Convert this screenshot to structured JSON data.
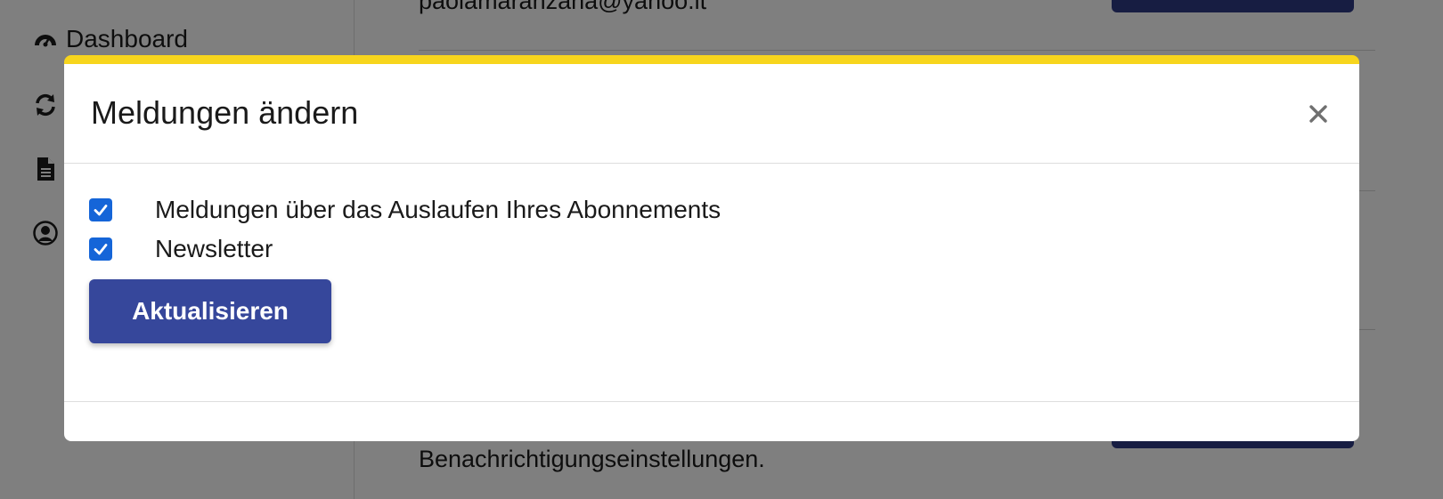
{
  "sidebar": {
    "items": [
      {
        "label": "Dashboard",
        "icon": "dashboard-icon"
      },
      {
        "label": "",
        "icon": "sync-icon"
      },
      {
        "label": "",
        "icon": "document-icon"
      },
      {
        "label": "",
        "icon": "user-circle-icon"
      }
    ]
  },
  "main": {
    "email": "paolamaranzana@yahoo.it",
    "footer_text": "Benachrichtigungseinstellungen."
  },
  "modal": {
    "title": "Meldungen ändern",
    "close_icon": "close-icon",
    "options": [
      {
        "label": "Meldungen über das Auslaufen Ihres Abonnements",
        "checked": true
      },
      {
        "label": "Newsletter",
        "checked": true
      }
    ],
    "submit_label": "Aktualisieren"
  },
  "colors": {
    "accent_top": "#f7d51d",
    "primary_button": "#36479b",
    "checkbox": "#1565d8",
    "backdrop": "rgba(0,0,0,0.5)"
  }
}
